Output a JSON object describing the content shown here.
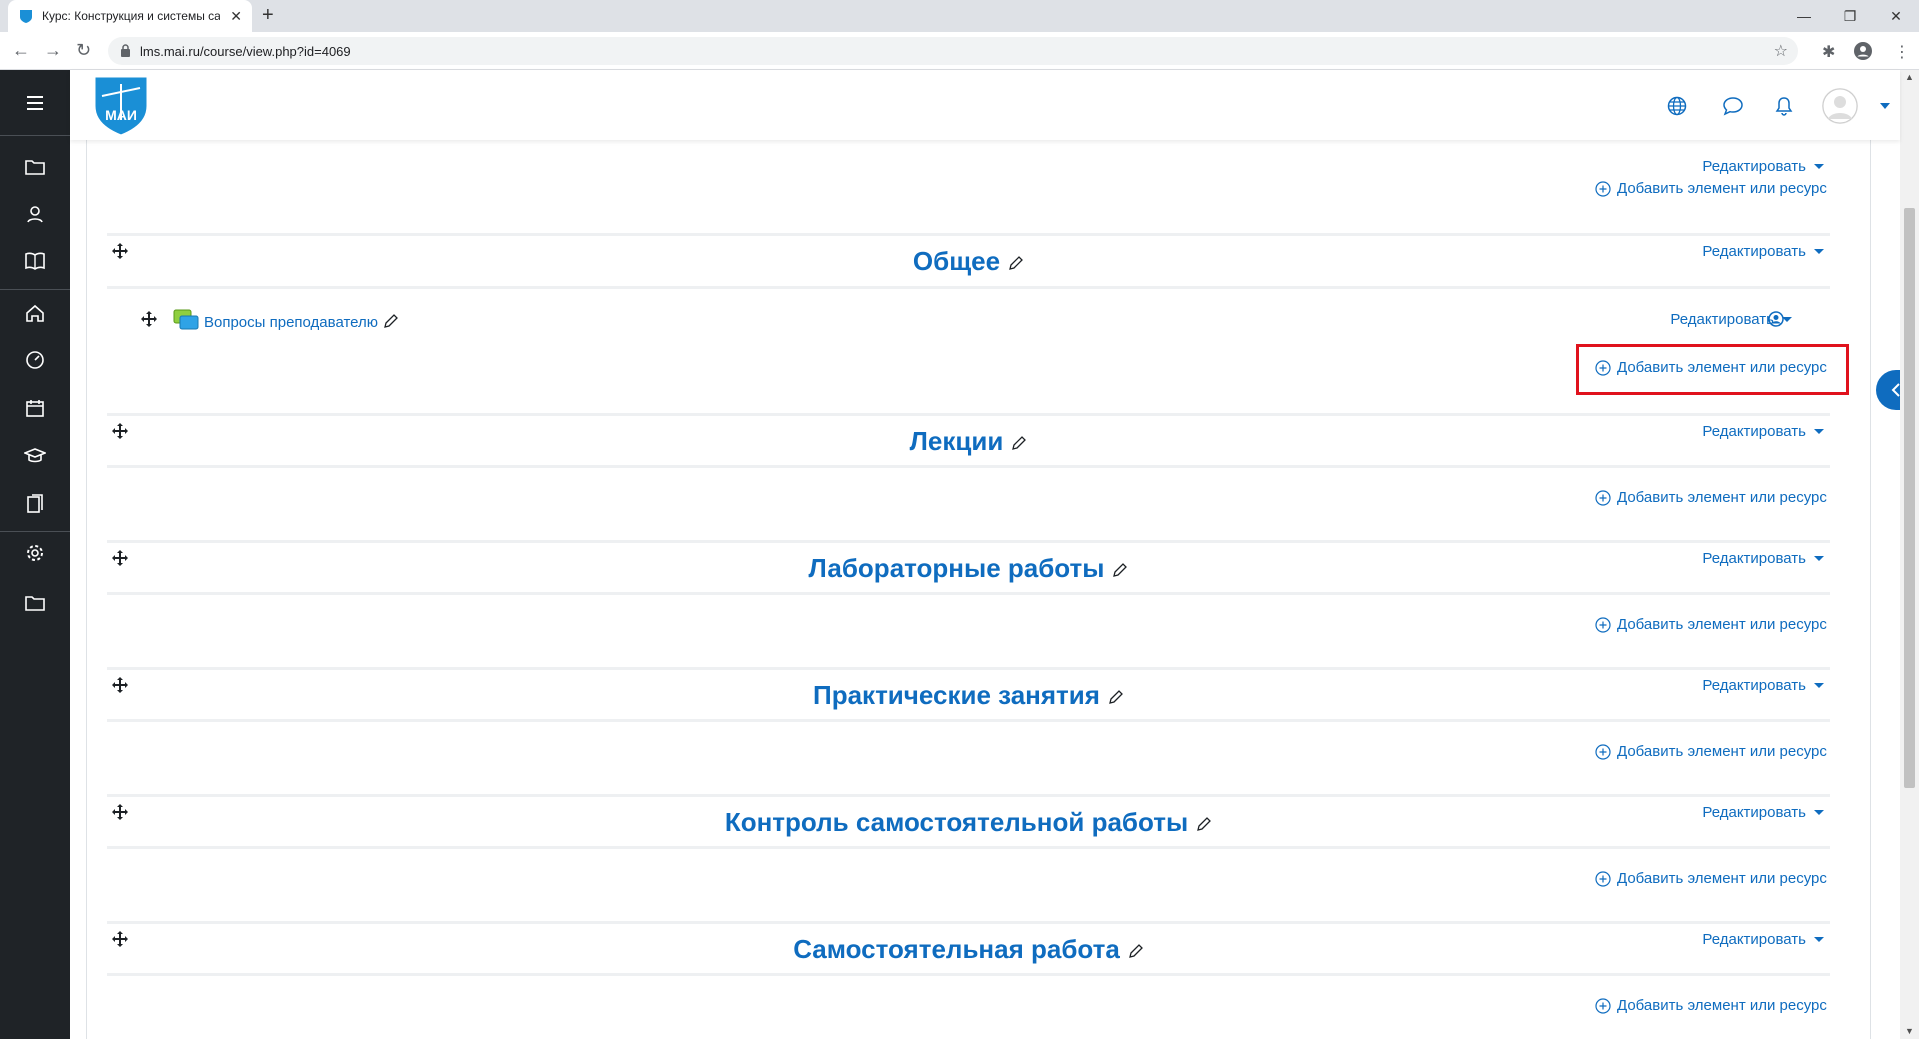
{
  "browser": {
    "tab_title": "Курс: Конструкция и системы са",
    "url": "lms.mai.ru/course/view.php?id=4069"
  },
  "header": {
    "logo_text": "МАИ"
  },
  "labels": {
    "edit": "Редактировать",
    "add_resource": "Добавить элемент или ресурс"
  },
  "activity": {
    "name": "Вопросы преподавателю"
  },
  "sections": [
    {
      "title": "Общее"
    },
    {
      "title": "Лекции"
    },
    {
      "title": "Лабораторные работы"
    },
    {
      "title": "Практические занятия"
    },
    {
      "title": "Контроль самостоятельной работы"
    },
    {
      "title": "Самостоятельная работа"
    }
  ],
  "colors": {
    "accent": "#0f6cbf",
    "nav_bg": "#1f2327",
    "highlight": "#e0121d"
  }
}
